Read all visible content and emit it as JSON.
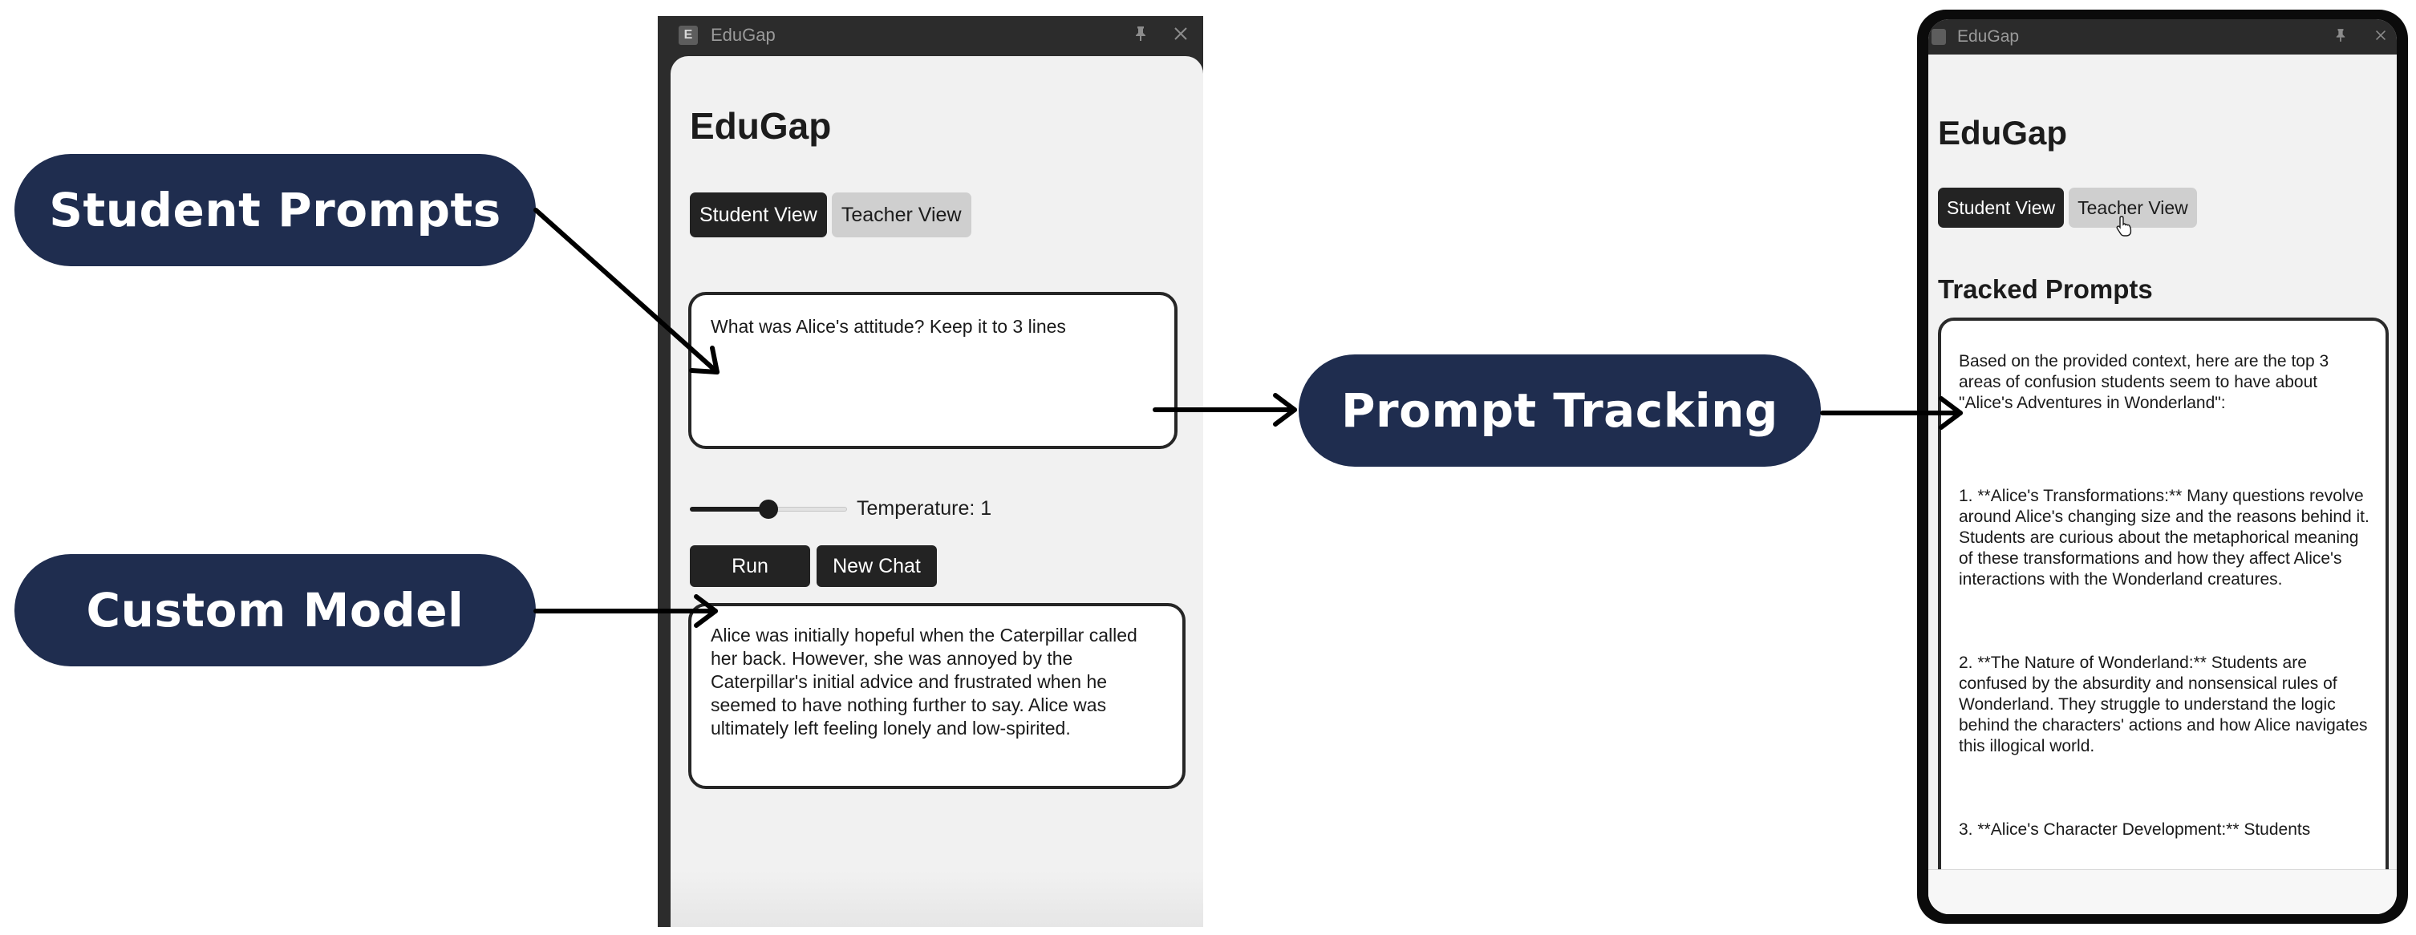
{
  "callouts": {
    "student_prompts": "Student Prompts",
    "custom_model": "Custom Model",
    "prompt_tracking": "Prompt Tracking"
  },
  "colors": {
    "callout_bg": "#1f2d4f",
    "callout_text": "#ffffff",
    "arrow": "#000000",
    "window_chrome": "#2c2c2c",
    "panel_bg": "#f1f1f1",
    "button_dark": "#232323",
    "button_light": "#cfcfcf"
  },
  "desktop_window": {
    "app_badge": "E",
    "window_title": "EduGap",
    "titlebar_icons": [
      "pin-icon",
      "close-icon"
    ],
    "app_title": "EduGap",
    "tabs": [
      {
        "label": "Student View",
        "active": true
      },
      {
        "label": "Teacher View",
        "active": false
      }
    ],
    "prompt_text": "What was Alice's attitude? Keep it to 3 lines",
    "temperature": {
      "label": "Temperature: 1",
      "value": 1,
      "slider_fraction": 0.5
    },
    "run_label": "Run",
    "new_chat_label": "New Chat",
    "output_text": "Alice was initially hopeful when the Caterpillar called her back. However, she was annoyed by the Caterpillar's initial advice and frustrated when he seemed to have nothing further to say. Alice was ultimately left feeling lonely and low-spirited."
  },
  "phone_window": {
    "window_title": "EduGap",
    "titlebar_icons": [
      "pin-icon",
      "close-icon"
    ],
    "app_title": "EduGap",
    "tabs": [
      {
        "label": "Student View",
        "active": true
      },
      {
        "label": "Teacher View",
        "active": false,
        "hovered": true
      }
    ],
    "section_title": "Tracked Prompts",
    "tracked_intro": "Based on the provided context, here are the top 3 areas of confusion students seem to have about \"Alice's Adventures in Wonderland\":",
    "tracked_items": [
      "1. **Alice's Transformations:** Many questions revolve around Alice's changing size and the reasons behind it. Students are curious about the metaphorical meaning of these transformations and how they affect Alice's interactions with the Wonderland creatures.",
      "2. **The Nature of Wonderland:** Students are confused by the absurdity and nonsensical rules of Wonderland. They struggle to understand the logic behind the characters' actions and how Alice navigates this illogical world.",
      "3. **Alice's Character Development:** Students"
    ]
  }
}
